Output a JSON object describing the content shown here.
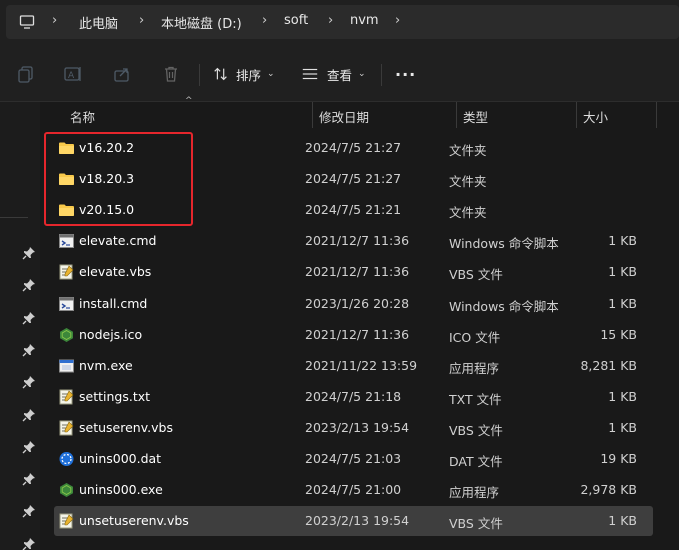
{
  "address": {
    "crumbs": [
      "此电脑",
      "本地磁盘 (D:)",
      "soft",
      "nvm"
    ]
  },
  "toolbar": {
    "sort_label": "排序",
    "view_label": "查看",
    "more_label": "···"
  },
  "columns": {
    "name": "名称",
    "date": "修改日期",
    "type": "类型",
    "size": "大小"
  },
  "files": [
    {
      "name": "v16.20.2",
      "date": "2024/7/5 21:27",
      "type": "文件夹",
      "size": "",
      "icon": "folder-icon"
    },
    {
      "name": "v18.20.3",
      "date": "2024/7/5 21:27",
      "type": "文件夹",
      "size": "",
      "icon": "folder-icon"
    },
    {
      "name": "v20.15.0",
      "date": "2024/7/5 21:21",
      "type": "文件夹",
      "size": "",
      "icon": "folder-icon"
    },
    {
      "name": "elevate.cmd",
      "date": "2021/12/7 11:36",
      "type": "Windows 命令脚本",
      "size": "1 KB",
      "icon": "cmd-file-icon"
    },
    {
      "name": "elevate.vbs",
      "date": "2021/12/7 11:36",
      "type": "VBS 文件",
      "size": "1 KB",
      "icon": "script-file-icon"
    },
    {
      "name": "install.cmd",
      "date": "2023/1/26 20:28",
      "type": "Windows 命令脚本",
      "size": "1 KB",
      "icon": "cmd-file-icon"
    },
    {
      "name": "nodejs.ico",
      "date": "2021/12/7 11:36",
      "type": "ICO 文件",
      "size": "15 KB",
      "icon": "nodejs-icon"
    },
    {
      "name": "nvm.exe",
      "date": "2021/11/22 13:59",
      "type": "应用程序",
      "size": "8,281 KB",
      "icon": "exe-file-icon"
    },
    {
      "name": "settings.txt",
      "date": "2024/7/5 21:18",
      "type": "TXT 文件",
      "size": "1 KB",
      "icon": "text-file-icon"
    },
    {
      "name": "setuserenv.vbs",
      "date": "2023/2/13 19:54",
      "type": "VBS 文件",
      "size": "1 KB",
      "icon": "script-file-icon"
    },
    {
      "name": "unins000.dat",
      "date": "2024/7/5 21:03",
      "type": "DAT 文件",
      "size": "19 KB",
      "icon": "dat-file-icon"
    },
    {
      "name": "unins000.exe",
      "date": "2024/7/5 21:00",
      "type": "应用程序",
      "size": "2,978 KB",
      "icon": "nodejs-icon"
    },
    {
      "name": "unsetuserenv.vbs",
      "date": "2023/2/13 19:54",
      "type": "VBS 文件",
      "size": "1 KB",
      "icon": "script-file-icon"
    }
  ],
  "selected_index": 12,
  "colors": {
    "highlight_box": "#e5262c",
    "folder": "#f8c94a",
    "nodejs": "#3c873a"
  }
}
